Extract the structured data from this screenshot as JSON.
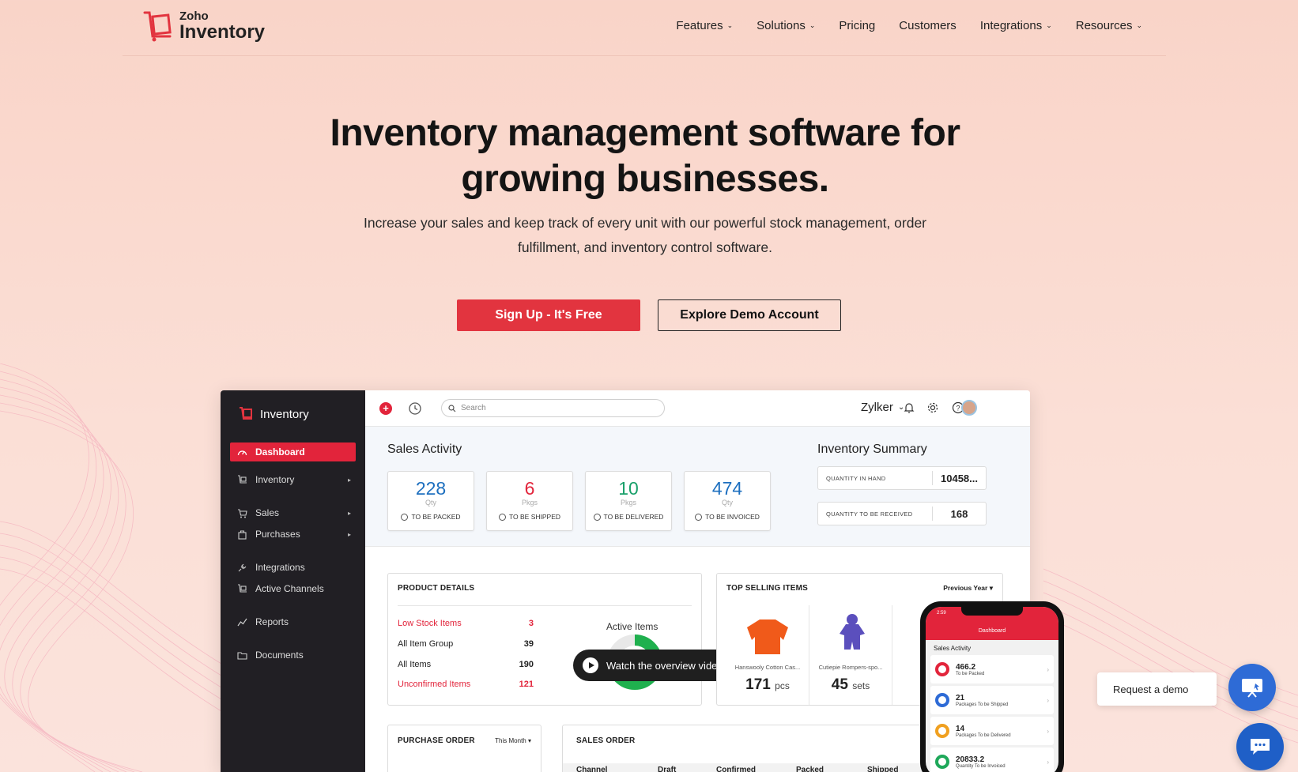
{
  "brand": {
    "line1": "Zoho",
    "line2": "Inventory",
    "accent": "#e2343f"
  },
  "nav": [
    {
      "label": "Features",
      "dropdown": true
    },
    {
      "label": "Solutions",
      "dropdown": true
    },
    {
      "label": "Pricing",
      "dropdown": false
    },
    {
      "label": "Customers",
      "dropdown": false
    },
    {
      "label": "Integrations",
      "dropdown": true
    },
    {
      "label": "Resources",
      "dropdown": true
    }
  ],
  "hero": {
    "title_line1": "Inventory management software for",
    "title_line2": "growing businesses.",
    "subtitle_line1": "Increase your sales and keep track of every unit with our powerful stock management, order",
    "subtitle_line2": "fulfillment, and inventory control software.",
    "signup_label": "Sign Up - It's Free",
    "demo_label": "Explore Demo Account"
  },
  "app": {
    "brand": "Inventory",
    "sidebar": [
      {
        "label": "Dashboard",
        "icon": "dashboard-icon",
        "active": true,
        "arrow": false
      },
      {
        "label": "Inventory",
        "icon": "cart-icon",
        "active": false,
        "arrow": true
      },
      {
        "label": "Sales",
        "icon": "basket-icon",
        "active": false,
        "arrow": true
      },
      {
        "label": "Purchases",
        "icon": "bag-icon",
        "active": false,
        "arrow": true
      },
      {
        "label": "Integrations",
        "icon": "plug-icon",
        "active": false,
        "arrow": false
      },
      {
        "label": "Active Channels",
        "icon": "channels-icon",
        "active": false,
        "arrow": false
      },
      {
        "label": "Reports",
        "icon": "chart-icon",
        "active": false,
        "arrow": false
      },
      {
        "label": "Documents",
        "icon": "folder-icon",
        "active": false,
        "arrow": false
      }
    ],
    "search_placeholder": "Search",
    "org_name": "Zylker",
    "sales_activity": {
      "title": "Sales Activity",
      "cards": [
        {
          "value": "228",
          "unit": "Qty",
          "label": "TO BE PACKED",
          "color": "#1d6fbf"
        },
        {
          "value": "6",
          "unit": "Pkgs",
          "label": "TO BE SHIPPED",
          "color": "#e2243b"
        },
        {
          "value": "10",
          "unit": "Pkgs",
          "label": "TO BE DELIVERED",
          "color": "#18a06a"
        },
        {
          "value": "474",
          "unit": "Qty",
          "label": "TO BE INVOICED",
          "color": "#1d6fbf"
        }
      ]
    },
    "inventory_summary": {
      "title": "Inventory Summary",
      "rows": [
        {
          "label": "QUANTITY IN HAND",
          "value": "10458..."
        },
        {
          "label": "QUANTITY TO BE RECEIVED",
          "value": "168"
        }
      ]
    },
    "product_details": {
      "title": "PRODUCT DETAILS",
      "rows": [
        {
          "label": "Low Stock Items",
          "value": "3",
          "red": true
        },
        {
          "label": "All Item Group",
          "value": "39",
          "red": false
        },
        {
          "label": "All Items",
          "value": "190",
          "red": false
        },
        {
          "label": "Unconfirmed Items",
          "value": "121",
          "red": true
        }
      ],
      "active_items_label": "Active Items",
      "video_label": "Watch the overview video"
    },
    "top_selling": {
      "title": "TOP SELLING ITEMS",
      "filter": "Previous Year",
      "items": [
        {
          "name": "Hanswooly Cotton Cas...",
          "qty": "171",
          "unit": "pcs",
          "color": "#f05a1a"
        },
        {
          "name": "Cutiepie Rompers-spo...",
          "qty": "45",
          "unit": "sets",
          "color": "#5b4fbd"
        }
      ]
    },
    "purchase_order": {
      "title": "PURCHASE ORDER",
      "filter": "This Month"
    },
    "sales_order": {
      "title": "SALES ORDER",
      "columns": [
        "Channel",
        "Draft",
        "Confirmed",
        "Packed",
        "Shipped"
      ]
    }
  },
  "phone": {
    "time": "2:59",
    "title": "Dashboard",
    "section": "Sales Activity",
    "rows": [
      {
        "value": "466.2",
        "label": "To be Packed",
        "color": "#e2243b"
      },
      {
        "value": "21",
        "label": "Packages To be Shipped",
        "color": "#2e6bd6"
      },
      {
        "value": "14",
        "label": "Packages To be Delivered",
        "color": "#f0a020"
      },
      {
        "value": "20833.2",
        "label": "Quantity To be Invoiced",
        "color": "#1fa85a"
      }
    ]
  },
  "floating": {
    "request_demo": "Request a demo"
  }
}
